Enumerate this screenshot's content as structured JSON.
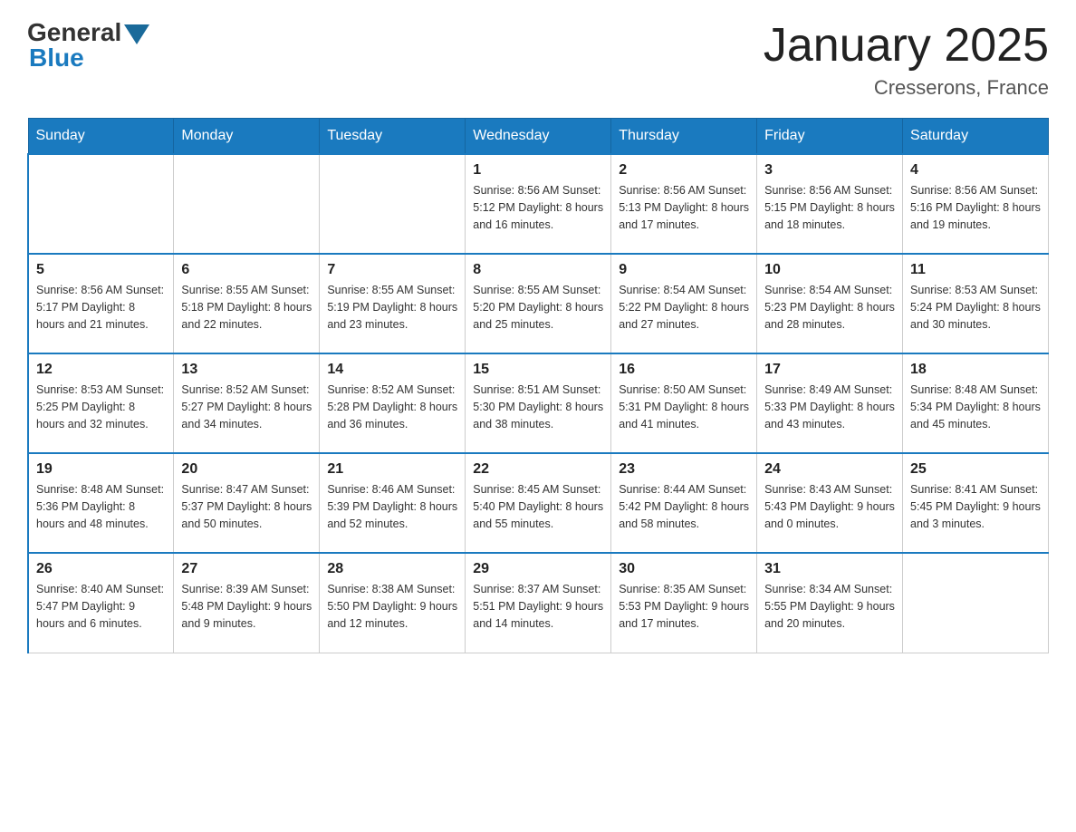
{
  "logo": {
    "general": "General",
    "blue": "Blue"
  },
  "title": "January 2025",
  "subtitle": "Cresserons, France",
  "days_of_week": [
    "Sunday",
    "Monday",
    "Tuesday",
    "Wednesday",
    "Thursday",
    "Friday",
    "Saturday"
  ],
  "weeks": [
    [
      {
        "day": "",
        "info": ""
      },
      {
        "day": "",
        "info": ""
      },
      {
        "day": "",
        "info": ""
      },
      {
        "day": "1",
        "info": "Sunrise: 8:56 AM\nSunset: 5:12 PM\nDaylight: 8 hours\nand 16 minutes."
      },
      {
        "day": "2",
        "info": "Sunrise: 8:56 AM\nSunset: 5:13 PM\nDaylight: 8 hours\nand 17 minutes."
      },
      {
        "day": "3",
        "info": "Sunrise: 8:56 AM\nSunset: 5:15 PM\nDaylight: 8 hours\nand 18 minutes."
      },
      {
        "day": "4",
        "info": "Sunrise: 8:56 AM\nSunset: 5:16 PM\nDaylight: 8 hours\nand 19 minutes."
      }
    ],
    [
      {
        "day": "5",
        "info": "Sunrise: 8:56 AM\nSunset: 5:17 PM\nDaylight: 8 hours\nand 21 minutes."
      },
      {
        "day": "6",
        "info": "Sunrise: 8:55 AM\nSunset: 5:18 PM\nDaylight: 8 hours\nand 22 minutes."
      },
      {
        "day": "7",
        "info": "Sunrise: 8:55 AM\nSunset: 5:19 PM\nDaylight: 8 hours\nand 23 minutes."
      },
      {
        "day": "8",
        "info": "Sunrise: 8:55 AM\nSunset: 5:20 PM\nDaylight: 8 hours\nand 25 minutes."
      },
      {
        "day": "9",
        "info": "Sunrise: 8:54 AM\nSunset: 5:22 PM\nDaylight: 8 hours\nand 27 minutes."
      },
      {
        "day": "10",
        "info": "Sunrise: 8:54 AM\nSunset: 5:23 PM\nDaylight: 8 hours\nand 28 minutes."
      },
      {
        "day": "11",
        "info": "Sunrise: 8:53 AM\nSunset: 5:24 PM\nDaylight: 8 hours\nand 30 minutes."
      }
    ],
    [
      {
        "day": "12",
        "info": "Sunrise: 8:53 AM\nSunset: 5:25 PM\nDaylight: 8 hours\nand 32 minutes."
      },
      {
        "day": "13",
        "info": "Sunrise: 8:52 AM\nSunset: 5:27 PM\nDaylight: 8 hours\nand 34 minutes."
      },
      {
        "day": "14",
        "info": "Sunrise: 8:52 AM\nSunset: 5:28 PM\nDaylight: 8 hours\nand 36 minutes."
      },
      {
        "day": "15",
        "info": "Sunrise: 8:51 AM\nSunset: 5:30 PM\nDaylight: 8 hours\nand 38 minutes."
      },
      {
        "day": "16",
        "info": "Sunrise: 8:50 AM\nSunset: 5:31 PM\nDaylight: 8 hours\nand 41 minutes."
      },
      {
        "day": "17",
        "info": "Sunrise: 8:49 AM\nSunset: 5:33 PM\nDaylight: 8 hours\nand 43 minutes."
      },
      {
        "day": "18",
        "info": "Sunrise: 8:48 AM\nSunset: 5:34 PM\nDaylight: 8 hours\nand 45 minutes."
      }
    ],
    [
      {
        "day": "19",
        "info": "Sunrise: 8:48 AM\nSunset: 5:36 PM\nDaylight: 8 hours\nand 48 minutes."
      },
      {
        "day": "20",
        "info": "Sunrise: 8:47 AM\nSunset: 5:37 PM\nDaylight: 8 hours\nand 50 minutes."
      },
      {
        "day": "21",
        "info": "Sunrise: 8:46 AM\nSunset: 5:39 PM\nDaylight: 8 hours\nand 52 minutes."
      },
      {
        "day": "22",
        "info": "Sunrise: 8:45 AM\nSunset: 5:40 PM\nDaylight: 8 hours\nand 55 minutes."
      },
      {
        "day": "23",
        "info": "Sunrise: 8:44 AM\nSunset: 5:42 PM\nDaylight: 8 hours\nand 58 minutes."
      },
      {
        "day": "24",
        "info": "Sunrise: 8:43 AM\nSunset: 5:43 PM\nDaylight: 9 hours\nand 0 minutes."
      },
      {
        "day": "25",
        "info": "Sunrise: 8:41 AM\nSunset: 5:45 PM\nDaylight: 9 hours\nand 3 minutes."
      }
    ],
    [
      {
        "day": "26",
        "info": "Sunrise: 8:40 AM\nSunset: 5:47 PM\nDaylight: 9 hours\nand 6 minutes."
      },
      {
        "day": "27",
        "info": "Sunrise: 8:39 AM\nSunset: 5:48 PM\nDaylight: 9 hours\nand 9 minutes."
      },
      {
        "day": "28",
        "info": "Sunrise: 8:38 AM\nSunset: 5:50 PM\nDaylight: 9 hours\nand 12 minutes."
      },
      {
        "day": "29",
        "info": "Sunrise: 8:37 AM\nSunset: 5:51 PM\nDaylight: 9 hours\nand 14 minutes."
      },
      {
        "day": "30",
        "info": "Sunrise: 8:35 AM\nSunset: 5:53 PM\nDaylight: 9 hours\nand 17 minutes."
      },
      {
        "day": "31",
        "info": "Sunrise: 8:34 AM\nSunset: 5:55 PM\nDaylight: 9 hours\nand 20 minutes."
      },
      {
        "day": "",
        "info": ""
      }
    ]
  ]
}
